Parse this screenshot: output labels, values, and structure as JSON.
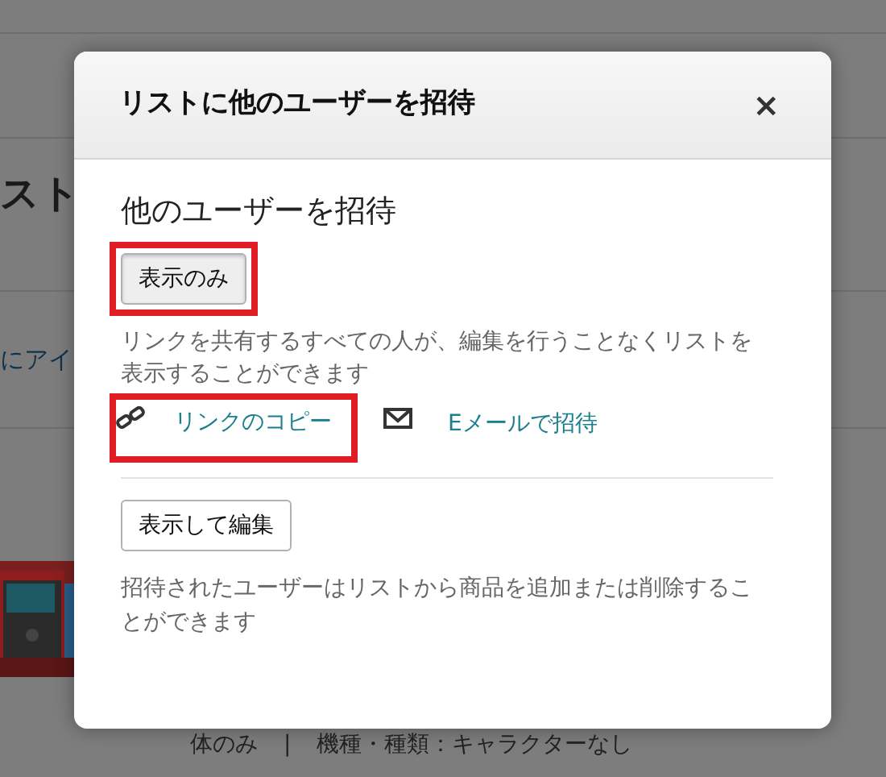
{
  "background": {
    "heading": "スト",
    "link_text": "にアイ",
    "product_details": [
      "体のみ",
      "|",
      "機種・種類：キャラクターなし"
    ]
  },
  "dialog": {
    "title": "リストに他のユーザーを招待",
    "close": "×",
    "section_title": "他のユーザーを招待",
    "options": [
      {
        "label": "表示のみ",
        "selected": true,
        "highlighted": true,
        "description": "リンクを共有するすべての人が、編集を行うことなくリストを表示することができます",
        "actions": [
          {
            "kind": "link",
            "label": "リンクのコピー",
            "highlighted": true
          },
          {
            "kind": "email",
            "label": "Eメールで招待",
            "highlighted": false
          }
        ]
      },
      {
        "label": "表示して編集",
        "selected": false,
        "highlighted": false,
        "description": "招待されたユーザーはリストから商品を追加または削除することができます"
      }
    ]
  }
}
